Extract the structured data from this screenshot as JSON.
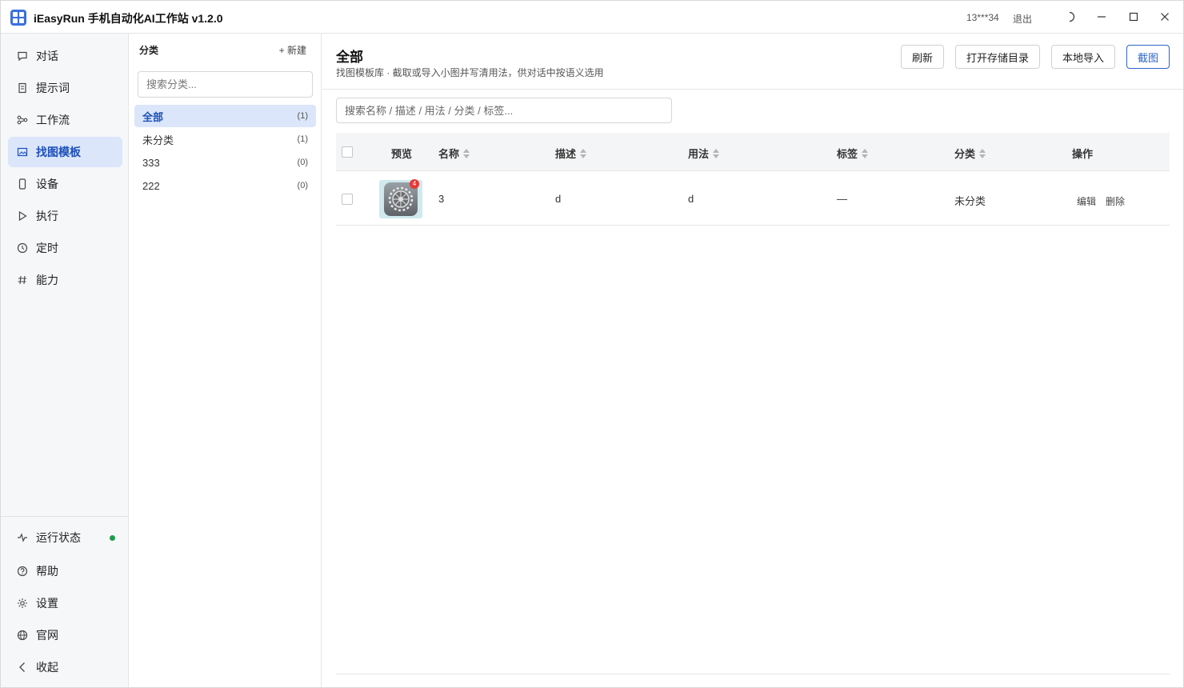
{
  "app": {
    "title": "iEasyRun 手机自动化AI工作站 v1.2.0",
    "user": "13***34",
    "logout": "退出"
  },
  "sidebar": {
    "items": [
      {
        "label": "对话",
        "icon": "chat-icon"
      },
      {
        "label": "提示词",
        "icon": "document-icon"
      },
      {
        "label": "工作流",
        "icon": "workflow-icon"
      },
      {
        "label": "找图模板",
        "icon": "image-icon",
        "active": true
      },
      {
        "label": "设备",
        "icon": "phone-icon"
      },
      {
        "label": "执行",
        "icon": "play-icon"
      },
      {
        "label": "定时",
        "icon": "clock-icon"
      },
      {
        "label": "能力",
        "icon": "hash-icon"
      }
    ],
    "bottom": [
      {
        "label": "运行状态",
        "icon": "pulse-icon"
      },
      {
        "label": "帮助",
        "icon": "help-icon"
      },
      {
        "label": "设置",
        "icon": "gear-icon"
      },
      {
        "label": "官网",
        "icon": "globe-icon"
      },
      {
        "label": "收起",
        "icon": "chevron-left-icon"
      }
    ],
    "status_color": "#1e9c4c"
  },
  "categories": {
    "header": "分类",
    "new_label": "+ 新建",
    "search_placeholder": "搜索分类...",
    "items": [
      {
        "label": "全部",
        "count": "(1)",
        "active": true
      },
      {
        "label": "未分类",
        "count": "(1)"
      },
      {
        "label": "333",
        "count": "(0)"
      },
      {
        "label": "222",
        "count": "(0)"
      }
    ]
  },
  "main": {
    "title": "全部",
    "subtitle": "找图模板库 · 截取或导入小图并写清用法，供对话中按语义选用",
    "buttons": {
      "refresh": "刷新",
      "open_dir": "打开存储目录",
      "local_import": "本地导入",
      "screenshot": "截图"
    },
    "search_placeholder": "搜索名称 / 描述 / 用法 / 分类 / 标签...",
    "accent": "#2f64c8"
  },
  "table": {
    "columns": {
      "preview": "预览",
      "name": "名称",
      "desc": "描述",
      "usage": "用法",
      "tags": "标签",
      "category": "分类",
      "actions": "操作"
    },
    "rows": [
      {
        "name": "3",
        "desc": "d",
        "usage": "d",
        "tags": "—",
        "category": "未分类",
        "badge": "4",
        "edit": "编辑",
        "delete": "删除"
      }
    ]
  }
}
